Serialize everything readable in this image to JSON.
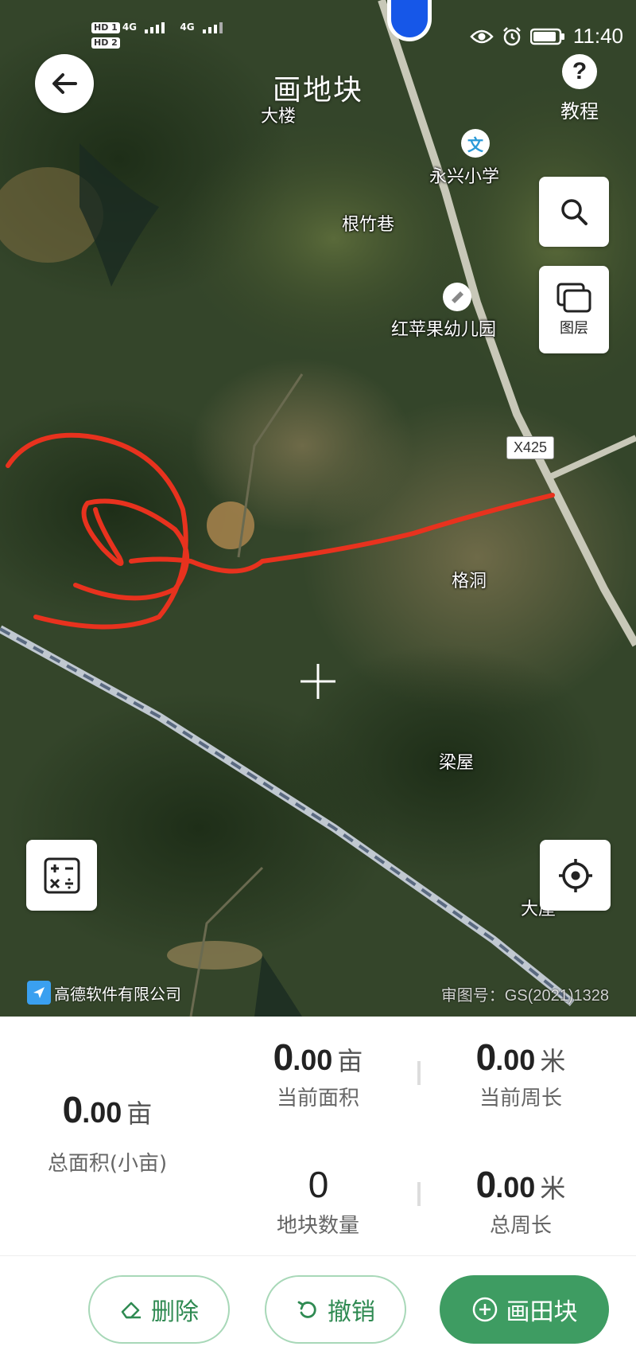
{
  "status": {
    "sim1": "HD 1",
    "sim2": "HD 2",
    "net1": "4G",
    "net2": "4G",
    "time": "11:40"
  },
  "header": {
    "title": "画地块",
    "help_label": "教程",
    "help_glyph": "?"
  },
  "map": {
    "layers_label": "图层",
    "road_badge": "X425",
    "places": [
      "大楼",
      "永兴小学",
      "根竹巷",
      "红苹果幼儿园",
      "格洞",
      "梁屋",
      "大屋"
    ],
    "poi_school_glyph": "文",
    "watermark": "高德软件有限公司",
    "approval": "审图号：GS(2021)1328",
    "drawn_line_color": "#e8321e"
  },
  "stats": {
    "total_area": {
      "int": "0",
      "dec": ".00",
      "unit": "亩",
      "label": "总面积(小亩)"
    },
    "current_area": {
      "int": "0",
      "dec": ".00",
      "unit": "亩",
      "label": "当前面积"
    },
    "current_perimeter": {
      "int": "0",
      "dec": ".00",
      "unit": "米",
      "label": "当前周长"
    },
    "plot_count": {
      "value": "0",
      "label": "地块数量"
    },
    "total_perimeter": {
      "int": "0",
      "dec": ".00",
      "unit": "米",
      "label": "总周长"
    }
  },
  "actions": {
    "delete": "删除",
    "undo": "撤销",
    "draw": "画田块"
  },
  "colors": {
    "accent": "#3e9c62",
    "accent_border": "#a8d8b8"
  }
}
